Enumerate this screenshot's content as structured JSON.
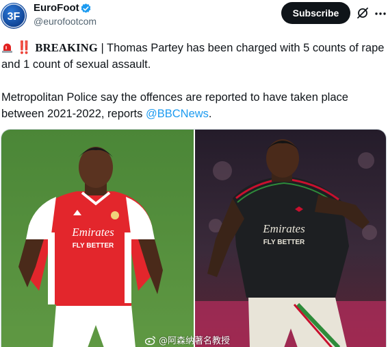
{
  "author": {
    "display_name": "EuroFoot",
    "handle": "@eurofootcom",
    "verified": true,
    "avatar_icon": "eurofoot-logo-icon"
  },
  "actions": {
    "subscribe_label": "Subscribe",
    "grok_icon": "grok-icon",
    "more_icon": "more-icon"
  },
  "post": {
    "emoji_1": "siren-emoji",
    "emoji_2": "‼️",
    "breaking_label": "BREAKING",
    "line1_rest": " | Thomas Partey has been charged with 5 counts of rape and 1 count of sexual assault.",
    "line2_text": "Metropolitan Police say the offences are reported to have taken place between 2021-2022, reports ",
    "mention": "@BBCNews",
    "line2_end": "."
  },
  "media": {
    "left_shirt_text_1": "Emirates",
    "left_shirt_text_2": "FLY BETTER",
    "right_shirt_text_1": "Emirates",
    "right_shirt_text_2": "FLY BETTER",
    "watermark_text": "@阿森纳著名教授"
  },
  "colors": {
    "accent_blue": "#1d9bf0",
    "subscribe_bg": "#0f1419",
    "arsenal_red": "#e3262c",
    "away_black": "#1d1f22"
  }
}
